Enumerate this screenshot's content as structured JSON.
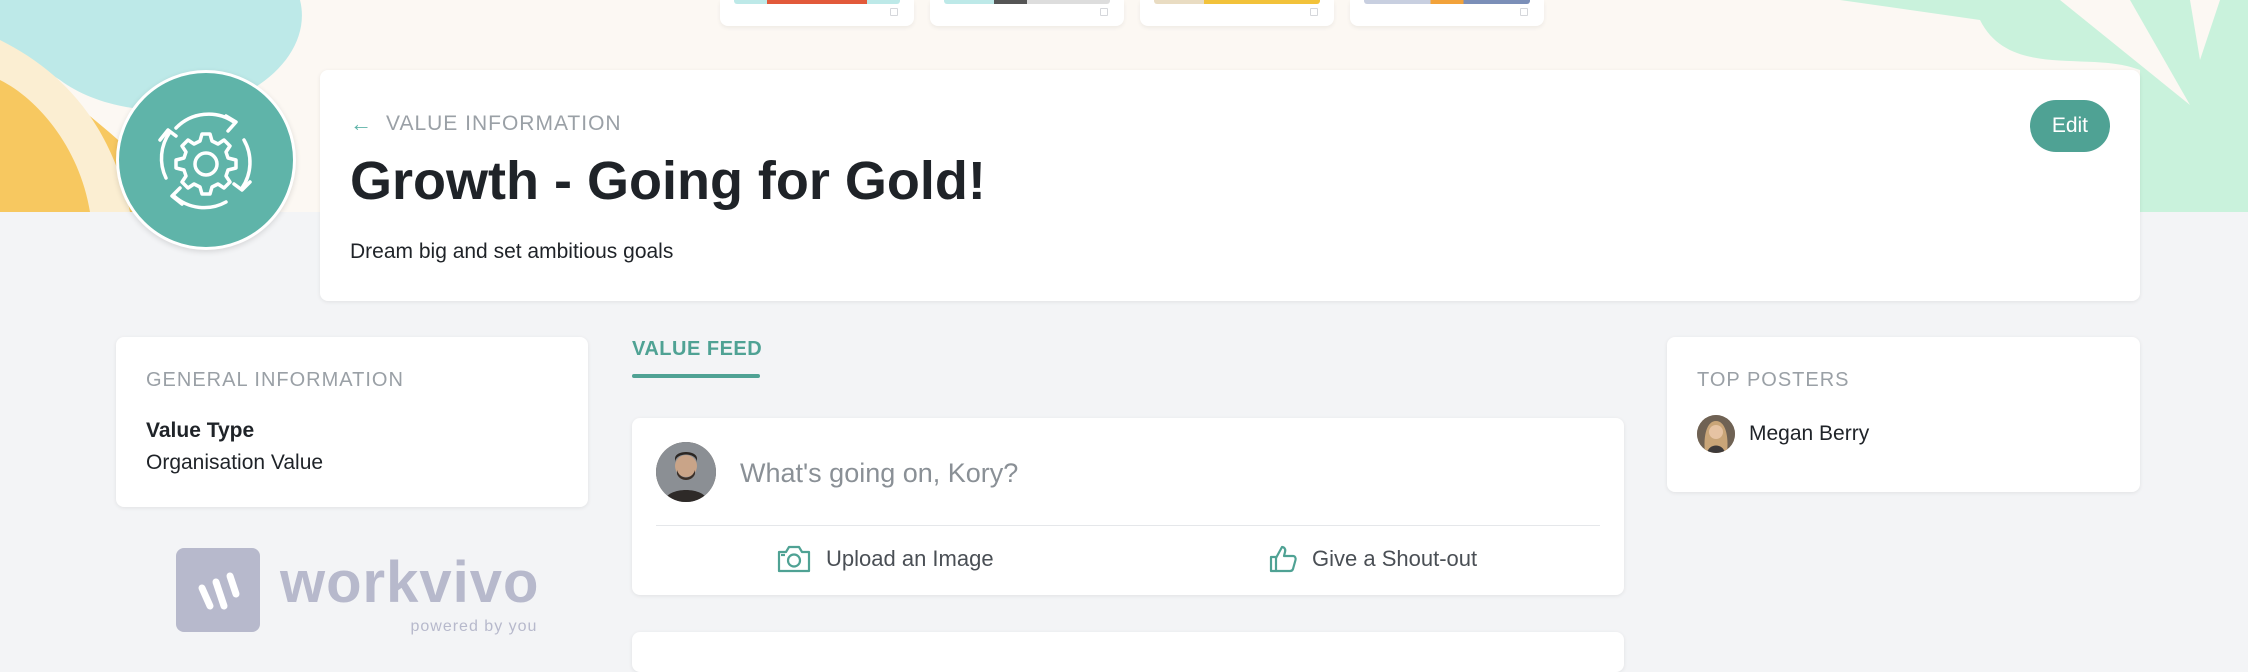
{
  "header": {
    "back_label": "VALUE INFORMATION",
    "title": "Growth - Going for Gold!",
    "description": "Dream big and set ambitious goals",
    "edit_label": "Edit"
  },
  "general_info": {
    "heading": "GENERAL INFORMATION",
    "key": "Value Type",
    "value": "Organisation Value"
  },
  "feed": {
    "tab_label": "VALUE FEED",
    "composer_placeholder": "What's going on, Kory?",
    "upload_label": "Upload an Image",
    "shoutout_label": "Give a Shout-out"
  },
  "top_posters": {
    "heading": "TOP POSTERS",
    "items": [
      {
        "name": "Megan Berry"
      }
    ]
  },
  "branding": {
    "wordmark": "workvivo",
    "tagline": "powered by you"
  },
  "colors": {
    "accent": "#4fa294",
    "icon_bg": "#5fb4a9",
    "muted": "#9aa0a6"
  },
  "icons": [
    "arrow-left-icon",
    "gear-cycle-icon",
    "camera-icon",
    "thumbs-up-icon"
  ]
}
